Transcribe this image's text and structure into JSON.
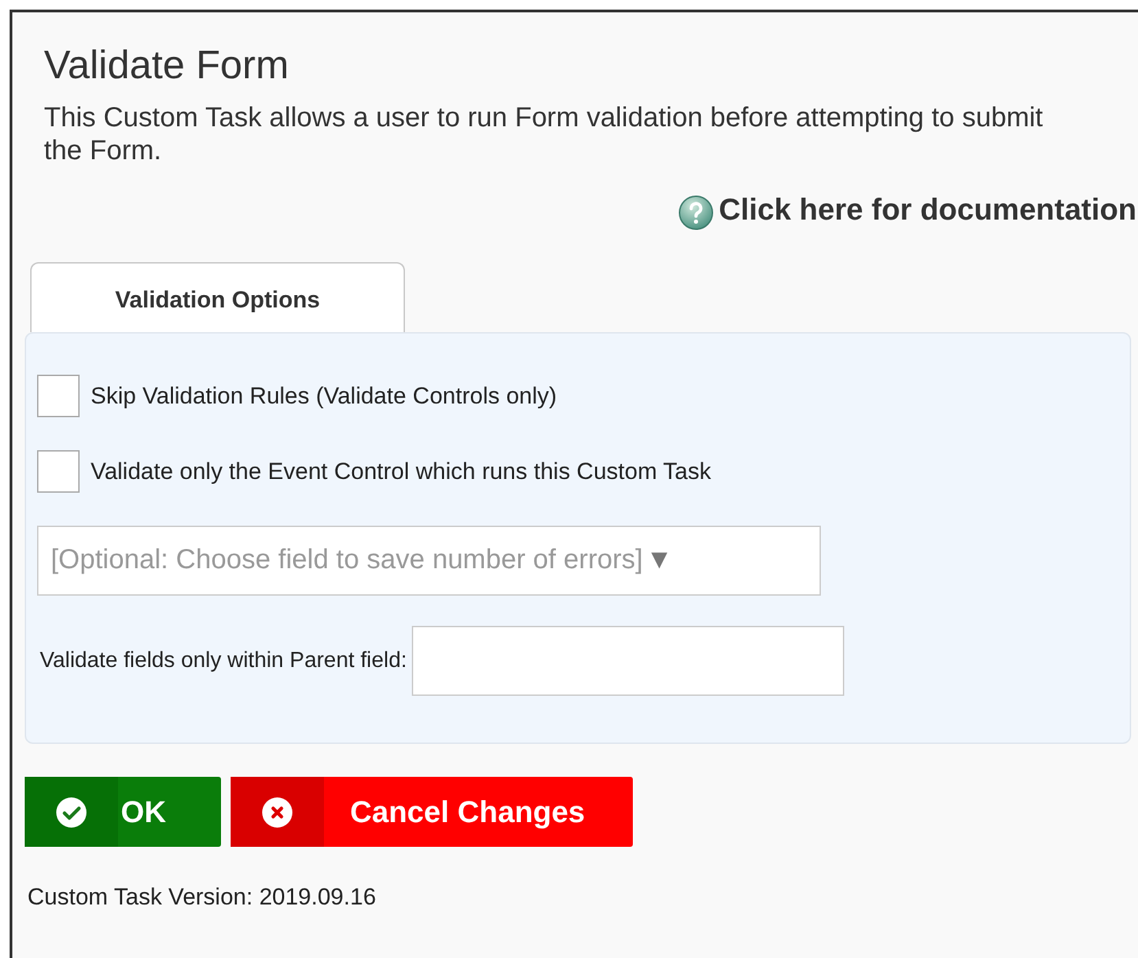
{
  "title": "Validate Form",
  "description": "This Custom Task allows a user to run Form validation before attempting to submit the Form.",
  "doc_link": "Click here for documentation",
  "tabs": [
    {
      "label": "Validation Options",
      "selected": true
    }
  ],
  "options": [
    {
      "label": "Skip Validation Rules (Validate Controls only)",
      "checked": false
    },
    {
      "label": "Validate only the Event Control which runs this Custom Task",
      "checked": false
    }
  ],
  "error_field": {
    "placeholder": "[Optional: Choose field to save number of errors]",
    "arrow": "▼"
  },
  "parent_field": {
    "label": "Validate fields only within Parent field:"
  },
  "buttons": [
    {
      "kind": "ok",
      "label": "OK"
    },
    {
      "kind": "cancel",
      "label": "Cancel Changes"
    }
  ],
  "version": "Custom Task Version: 2019.09.16"
}
